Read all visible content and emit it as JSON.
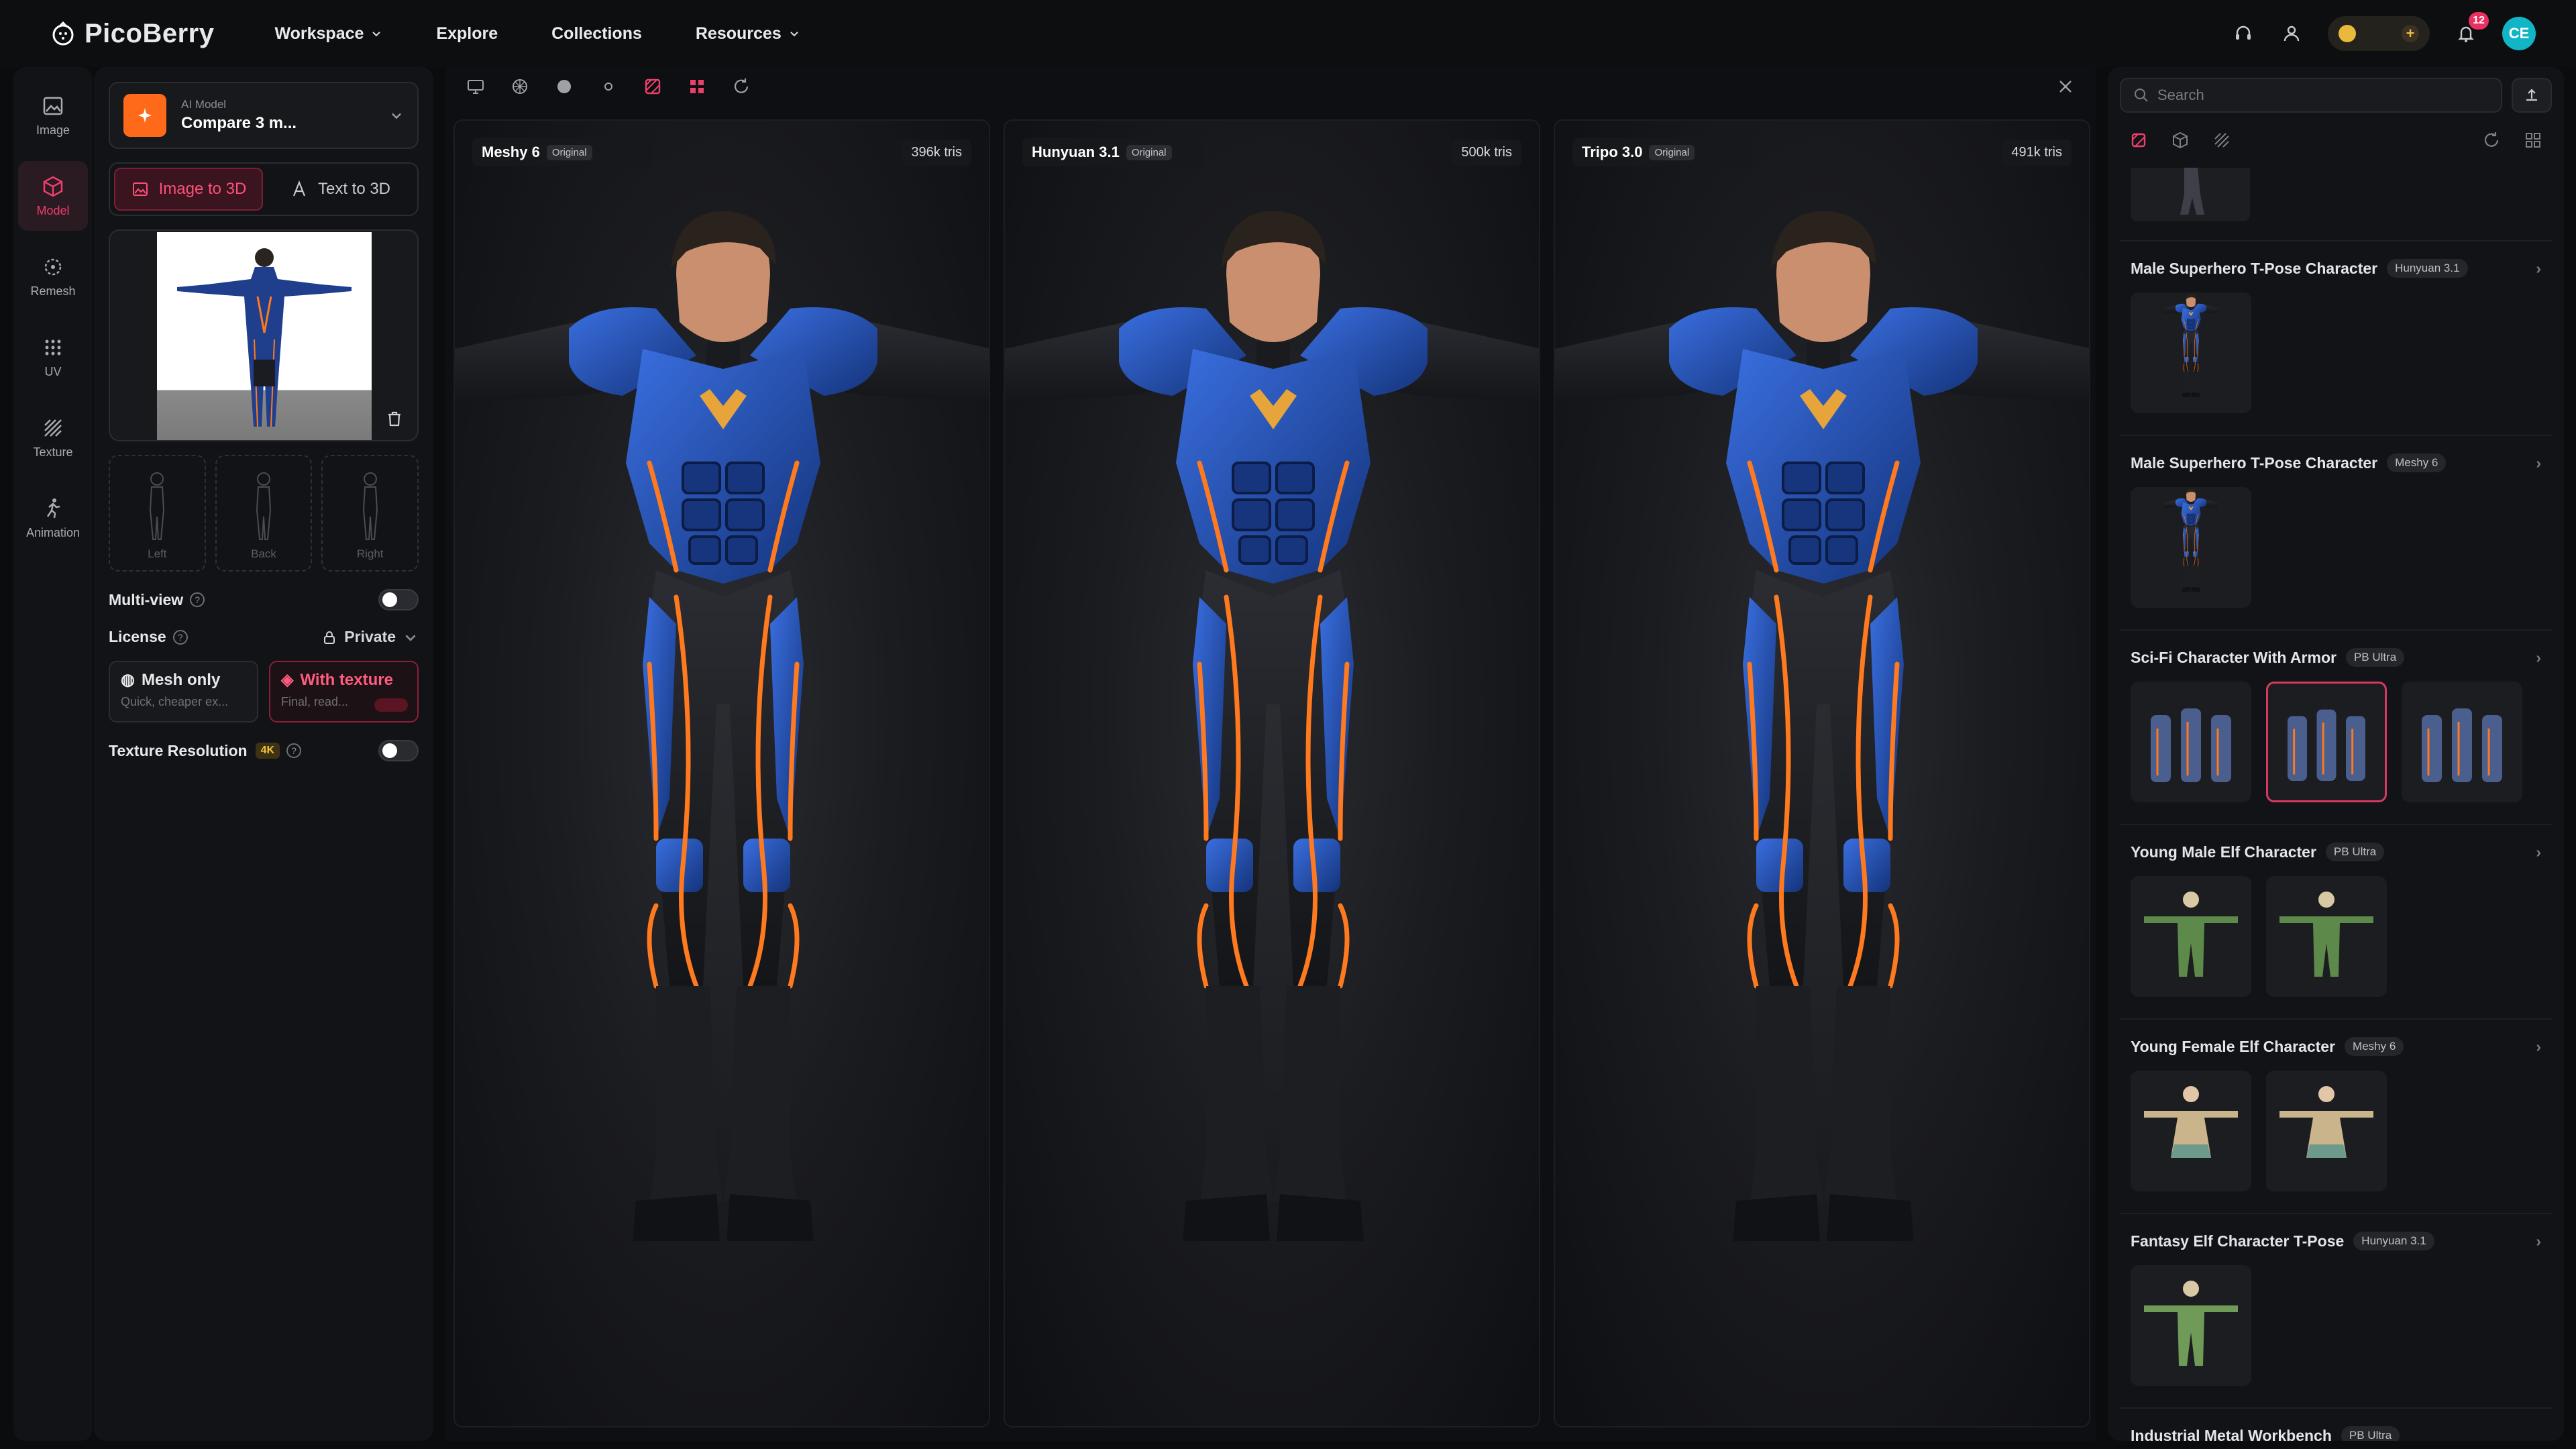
{
  "app": {
    "name": "PicoBerry"
  },
  "nav": [
    "Workspace",
    "Explore",
    "Collections",
    "Resources"
  ],
  "header": {
    "notifications": "12",
    "user_initials": "CE"
  },
  "rail": [
    {
      "label": "Image",
      "icon": "image-icon"
    },
    {
      "label": "Model",
      "icon": "cube-icon"
    },
    {
      "label": "Remesh",
      "icon": "remesh-icon"
    },
    {
      "label": "UV",
      "icon": "uv-grid-icon"
    },
    {
      "label": "Texture",
      "icon": "texture-icon"
    },
    {
      "label": "Animation",
      "icon": "running-figure-icon"
    }
  ],
  "panel": {
    "model_caption": "AI Model",
    "model_value": "Compare 3 m...",
    "mode_tabs": [
      "Image to 3D",
      "Text to 3D"
    ],
    "view_slots": [
      "Left",
      "Back",
      "Right"
    ],
    "multiview_label": "Multi-view",
    "license_label": "License",
    "license_value": "Private",
    "output_options": [
      {
        "title": "Mesh only",
        "subtitle": "Quick, cheaper ex..."
      },
      {
        "title": "With texture",
        "subtitle": "Final, read..."
      }
    ],
    "texture_res_label": "Texture Resolution",
    "texture_res_badge": "4K"
  },
  "viewer": {
    "panes": [
      {
        "name": "Meshy 6",
        "badge": "Original",
        "tris": "396k tris"
      },
      {
        "name": "Hunyuan 3.1",
        "badge": "Original",
        "tris": "500k tris"
      },
      {
        "name": "Tripo 3.0",
        "badge": "Original",
        "tris": "491k tris"
      }
    ]
  },
  "library": {
    "search_placeholder": "Search",
    "items": [
      {
        "title": "Male Superhero T-Pose Character",
        "badge": "Hunyuan 3.1"
      },
      {
        "title": "Male Superhero T-Pose Character",
        "badge": "Meshy 6"
      },
      {
        "title": "Sci-Fi Character With Armor",
        "badge": "PB Ultra"
      },
      {
        "title": "Young Male Elf Character",
        "badge": "PB Ultra"
      },
      {
        "title": "Young Female Elf Character",
        "badge": "Meshy 6"
      },
      {
        "title": "Fantasy Elf Character T-Pose",
        "badge": "Hunyuan 3.1"
      }
    ],
    "last_partial": {
      "title": "Industrial Metal Workbench",
      "badge": "PB Ultra"
    }
  },
  "colors": {
    "accent": "#ee3f6a",
    "orange": "#ff6a1a",
    "suit_blue": "#1f4fb0",
    "trim_orange": "#ff7a1e"
  }
}
